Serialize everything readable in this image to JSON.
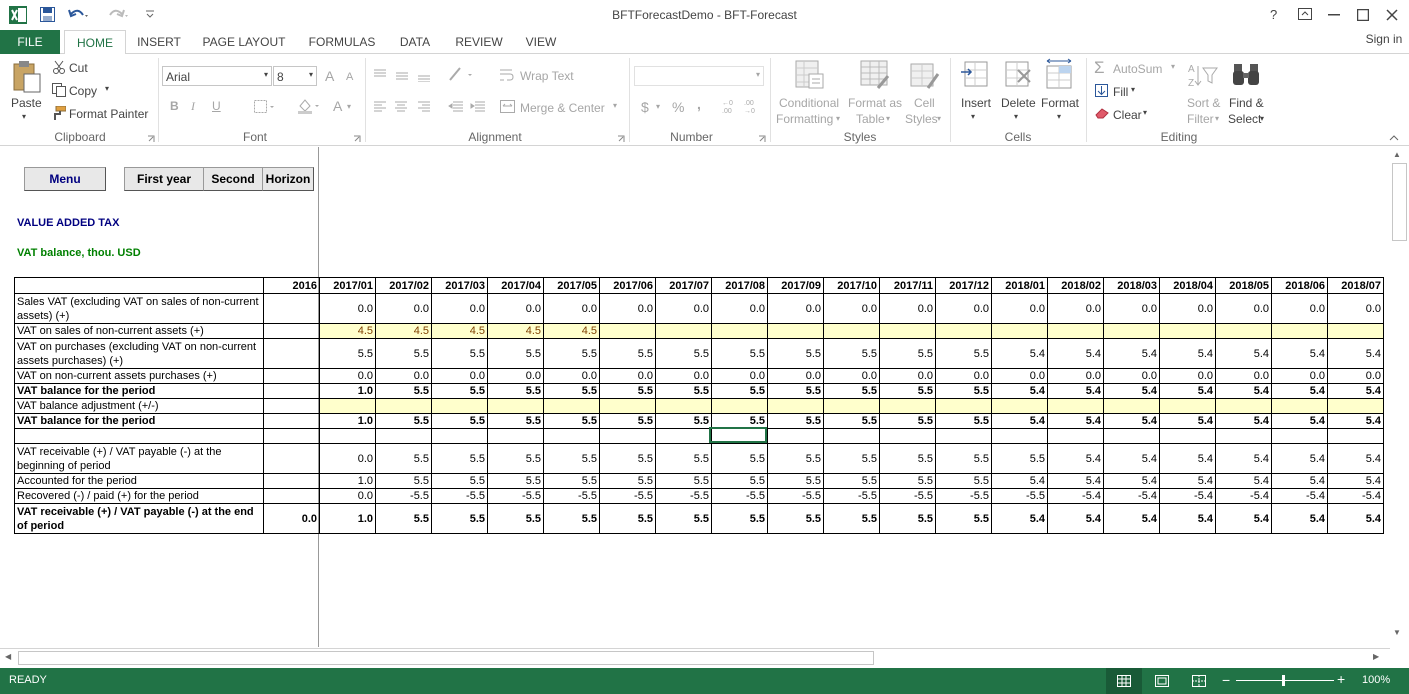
{
  "window": {
    "title": "BFTForecastDemo - BFT-Forecast",
    "help": "?",
    "controls": [
      "restore",
      "minimize",
      "maximize",
      "close"
    ]
  },
  "tabs": {
    "file": "FILE",
    "items": [
      "HOME",
      "INSERT",
      "PAGE LAYOUT",
      "FORMULAS",
      "DATA",
      "REVIEW",
      "VIEW"
    ],
    "active": "HOME",
    "sign_in": "Sign in"
  },
  "ribbon": {
    "clipboard": {
      "paste": "Paste",
      "cut": "Cut",
      "copy": "Copy",
      "format_painter": "Format Painter",
      "label": "Clipboard"
    },
    "font": {
      "name": "Arial",
      "size": "8",
      "grow": "A",
      "shrink": "A",
      "bold": "B",
      "italic": "I",
      "underline": "U",
      "font_color": "A",
      "label": "Font"
    },
    "alignment": {
      "wrap": "Wrap Text",
      "merge": "Merge & Center",
      "label": "Alignment"
    },
    "number": {
      "format": "",
      "currency": "$",
      "percent": "%",
      "comma": ",",
      "label": "Number"
    },
    "styles": {
      "conditional": [
        "Conditional",
        "Formatting"
      ],
      "format_table": [
        "Format as",
        "Table"
      ],
      "cell_styles": [
        "Cell",
        "Styles"
      ],
      "label": "Styles"
    },
    "cells": {
      "insert": "Insert",
      "delete": "Delete",
      "format": "Format",
      "label": "Cells"
    },
    "editing": {
      "autosum": "AutoSum",
      "fill": "Fill",
      "clear": "Clear",
      "sort": [
        "Sort &",
        "Filter"
      ],
      "find": [
        "Find &",
        "Select"
      ],
      "label": "Editing"
    }
  },
  "sheet": {
    "buttons": {
      "menu": "Menu",
      "first_year": "First year",
      "second": "Second",
      "horizon": "Horizon"
    },
    "title": "VALUE ADDED TAX",
    "subtitle": "VAT balance, thou. USD",
    "columns": [
      "",
      "2016",
      "2017/01",
      "2017/02",
      "2017/03",
      "2017/04",
      "2017/05",
      "2017/06",
      "2017/07",
      "2017/08",
      "2017/09",
      "2017/10",
      "2017/11",
      "2017/12",
      "2018/01",
      "2018/02",
      "2018/03",
      "2018/04",
      "2018/05",
      "2018/06",
      "2018/07"
    ],
    "rows": [
      {
        "label": "Sales VAT (excluding VAT on sales of non-current assets) (+)",
        "values": [
          "",
          "0.0",
          "0.0",
          "0.0",
          "0.0",
          "0.0",
          "0.0",
          "0.0",
          "0.0",
          "0.0",
          "0.0",
          "0.0",
          "0.0",
          "0.0",
          "0.0",
          "0.0",
          "0.0",
          "0.0",
          "0.0",
          "0.0"
        ]
      },
      {
        "label": "VAT on sales of non-current assets (+)",
        "values": [
          "",
          "4.5",
          "4.5",
          "4.5",
          "4.5",
          "4.5",
          "",
          "",
          "",
          "",
          "",
          "",
          "",
          "",
          "",
          "",
          "",
          "",
          "",
          ""
        ]
      },
      {
        "label": "VAT on purchases (excluding VAT on non-current assets purchases) (+)",
        "values": [
          "",
          "5.5",
          "5.5",
          "5.5",
          "5.5",
          "5.5",
          "5.5",
          "5.5",
          "5.5",
          "5.5",
          "5.5",
          "5.5",
          "5.5",
          "5.4",
          "5.4",
          "5.4",
          "5.4",
          "5.4",
          "5.4",
          "5.4"
        ]
      },
      {
        "label": "VAT on non-current assets purchases (+)",
        "values": [
          "",
          "0.0",
          "0.0",
          "0.0",
          "0.0",
          "0.0",
          "0.0",
          "0.0",
          "0.0",
          "0.0",
          "0.0",
          "0.0",
          "0.0",
          "0.0",
          "0.0",
          "0.0",
          "0.0",
          "0.0",
          "0.0",
          "0.0"
        ]
      },
      {
        "label": "VAT balance for the period",
        "values": [
          "",
          "1.0",
          "5.5",
          "5.5",
          "5.5",
          "5.5",
          "5.5",
          "5.5",
          "5.5",
          "5.5",
          "5.5",
          "5.5",
          "5.5",
          "5.4",
          "5.4",
          "5.4",
          "5.4",
          "5.4",
          "5.4",
          "5.4"
        ]
      },
      {
        "label": "VAT balance adjustment (+/-)",
        "values": [
          "",
          "",
          "",
          "",
          "",
          "",
          "",
          "",
          "",
          "",
          "",
          "",
          "",
          "",
          "",
          "",
          "",
          "",
          "",
          ""
        ]
      },
      {
        "label": "VAT balance for the period",
        "values": [
          "",
          "1.0",
          "5.5",
          "5.5",
          "5.5",
          "5.5",
          "5.5",
          "5.5",
          "5.5",
          "5.5",
          "5.5",
          "5.5",
          "5.5",
          "5.4",
          "5.4",
          "5.4",
          "5.4",
          "5.4",
          "5.4",
          "5.4"
        ]
      },
      {
        "label": "",
        "values": [
          "",
          "",
          "",
          "",
          "",
          "",
          "",
          "",
          "",
          "",
          "",
          "",
          "",
          "",
          "",
          "",
          "",
          "",
          "",
          ""
        ]
      },
      {
        "label": "VAT receivable (+) / VAT payable (-) at the beginning of period",
        "values": [
          "",
          "0.0",
          "5.5",
          "5.5",
          "5.5",
          "5.5",
          "5.5",
          "5.5",
          "5.5",
          "5.5",
          "5.5",
          "5.5",
          "5.5",
          "5.5",
          "5.4",
          "5.4",
          "5.4",
          "5.4",
          "5.4",
          "5.4"
        ]
      },
      {
        "label": "Accounted for the period",
        "values": [
          "",
          "1.0",
          "5.5",
          "5.5",
          "5.5",
          "5.5",
          "5.5",
          "5.5",
          "5.5",
          "5.5",
          "5.5",
          "5.5",
          "5.5",
          "5.4",
          "5.4",
          "5.4",
          "5.4",
          "5.4",
          "5.4",
          "5.4"
        ]
      },
      {
        "label": "Recovered (-) / paid (+) for the period",
        "values": [
          "",
          "0.0",
          "-5.5",
          "-5.5",
          "-5.5",
          "-5.5",
          "-5.5",
          "-5.5",
          "-5.5",
          "-5.5",
          "-5.5",
          "-5.5",
          "-5.5",
          "-5.5",
          "-5.4",
          "-5.4",
          "-5.4",
          "-5.4",
          "-5.4",
          "-5.4"
        ]
      },
      {
        "label": "VAT receivable (+) / VAT payable (-) at the end of period",
        "values": [
          "0.0",
          "1.0",
          "5.5",
          "5.5",
          "5.5",
          "5.5",
          "5.5",
          "5.5",
          "5.5",
          "5.5",
          "5.5",
          "5.5",
          "5.5",
          "5.4",
          "5.4",
          "5.4",
          "5.4",
          "5.4",
          "5.4",
          "5.4"
        ]
      }
    ]
  },
  "status": {
    "ready": "READY",
    "zoom": "100%",
    "minus": "−",
    "plus": "+"
  },
  "colors": {
    "excel_green": "#217346",
    "input_yellow": "#ffffcc",
    "title_navy": "#000080",
    "subtitle_green": "#008000"
  }
}
